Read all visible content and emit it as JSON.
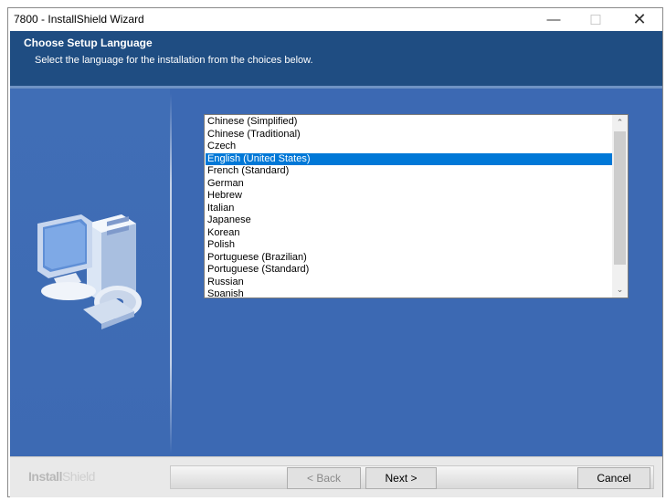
{
  "window": {
    "title": "7800 - InstallShield Wizard",
    "minimize_glyph": "—",
    "maximize_glyph": "☐",
    "close_glyph": "✕"
  },
  "header": {
    "title": "Choose Setup Language",
    "subtitle": "Select the language for the installation from the choices below."
  },
  "language_list": {
    "items": [
      "Chinese (Simplified)",
      "Chinese (Traditional)",
      "Czech",
      "English (United States)",
      "French (Standard)",
      "German",
      "Hebrew",
      "Italian",
      "Japanese",
      "Korean",
      "Polish",
      "Portuguese (Brazilian)",
      "Portuguese (Standard)",
      "Russian",
      "Spanish"
    ],
    "selected_index": 3,
    "scroll_up_glyph": "⌃",
    "scroll_down_glyph": "⌄"
  },
  "footer": {
    "brand_bold": "Install",
    "brand_light": "Shield",
    "back_label": "< Back",
    "next_label": "Next >",
    "cancel_label": "Cancel"
  },
  "colors": {
    "header_bg": "#1f4d82",
    "content_bg": "#3c69b3",
    "selection": "#0078d7"
  }
}
